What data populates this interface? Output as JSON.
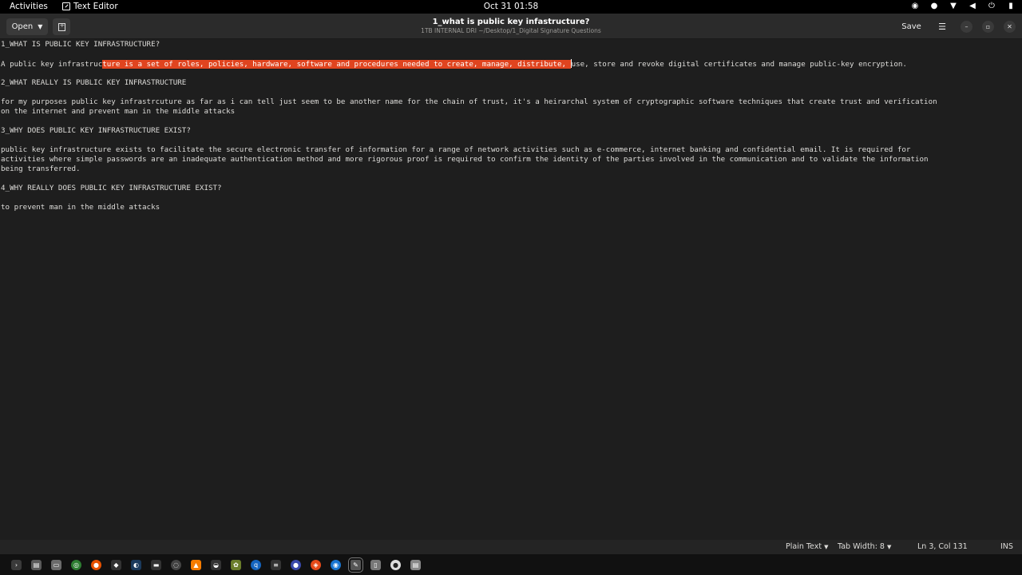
{
  "topbar": {
    "activities": "Activities",
    "app_name": "Text Editor",
    "clock": "Oct 31  01:58",
    "tray_icons": [
      "accessibility-icon",
      "steam-tray-icon",
      "wifi-icon",
      "volume-icon",
      "power-icon",
      "battery-icon"
    ]
  },
  "headerbar": {
    "open_label": "Open",
    "title": "1_what is public key infastructure?",
    "path": "1TB INTERNAL DRI ~/Desktop/1_Digital Signature Questions",
    "save_label": "Save"
  },
  "document": {
    "line1": "1_WHAT IS PUBLIC KEY INFRASTRUCTURE?",
    "line3_before": "A public key infrastruc",
    "line3_selected": "ture is a set of roles, policies, hardware, software and procedures needed to create, manage, distribute, ",
    "line3_after": "use, store and revoke digital certificates and manage public-key encryption.",
    "line5": "2_WHAT REALLY IS PUBLIC KEY INFRASTRUCTURE",
    "line7": "for my purposes public key infrastrcuture as far as i can tell just seem to be another name for the chain of trust, it's a heirarchal system of cryptographic software techniques that create trust and verification",
    "line8": "on the internet and prevent man in the middle attacks",
    "line10": "3_WHY DOES PUBLIC KEY INFRASTRUCTURE EXIST?",
    "line12": "public key infrastructure exists to facilitate the secure electronic transfer of information for a range of network activities such as e-commerce, internet banking and confidential email. It is required for",
    "line13": "activities where simple passwords are an inadequate authentication method and more rigorous proof is required to confirm the identity of the parties involved in the communication and to validate the information",
    "line14": "being transferred.",
    "line16": "4_WHY REALLY DOES PUBLIC KEY INFRASTRUCTURE EXIST?",
    "line18": "to prevent man in the middle attacks"
  },
  "statusbar": {
    "language": "Plain Text",
    "tab_width": "Tab Width: 8",
    "position": "Ln 3, Col 131",
    "mode": "INS"
  },
  "colors": {
    "selection": "#e0441f",
    "editor_bg": "#1e1e1e",
    "headerbar_bg": "#2b2b2b"
  },
  "dock": {
    "apps": [
      "terminal-icon",
      "files-icon",
      "nautilus-icon",
      "chrome-icon",
      "firefox-icon",
      "inkscape-icon",
      "steam-icon",
      "screen-icon",
      "gimp-icon",
      "vlc-icon",
      "blender-icon",
      "garden-icon",
      "qbittorrent-icon",
      "code-icon",
      "chat-icon",
      "brave-icon",
      "vscode-icon",
      "text-editor-icon",
      "document-icon",
      "obs-icon",
      "notes-icon"
    ]
  }
}
